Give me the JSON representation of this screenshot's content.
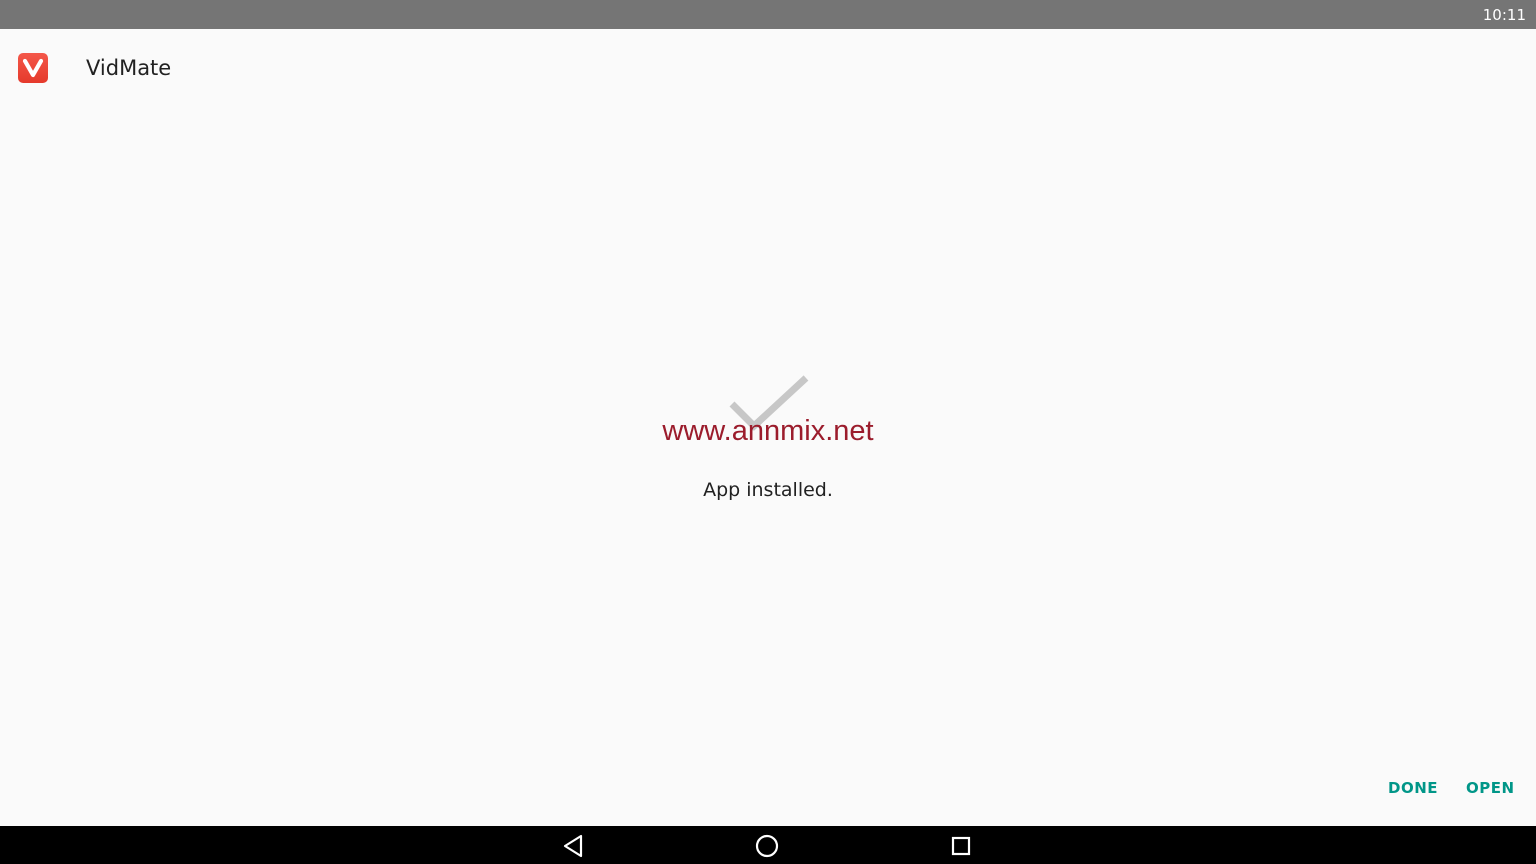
{
  "status_bar": {
    "time": "10:11"
  },
  "header": {
    "app_name": "VidMate",
    "icon": "vidmate-logo-icon",
    "icon_color": "#e53a2c"
  },
  "content": {
    "status_icon": "check-icon",
    "watermark": "www.annmix.net",
    "message": "App installed."
  },
  "actions": {
    "done_label": "DONE",
    "open_label": "OPEN",
    "accent_color": "#009688"
  },
  "nav_bar": {
    "back_icon": "back-triangle-icon",
    "home_icon": "home-circle-icon",
    "recents_icon": "recents-square-icon"
  }
}
